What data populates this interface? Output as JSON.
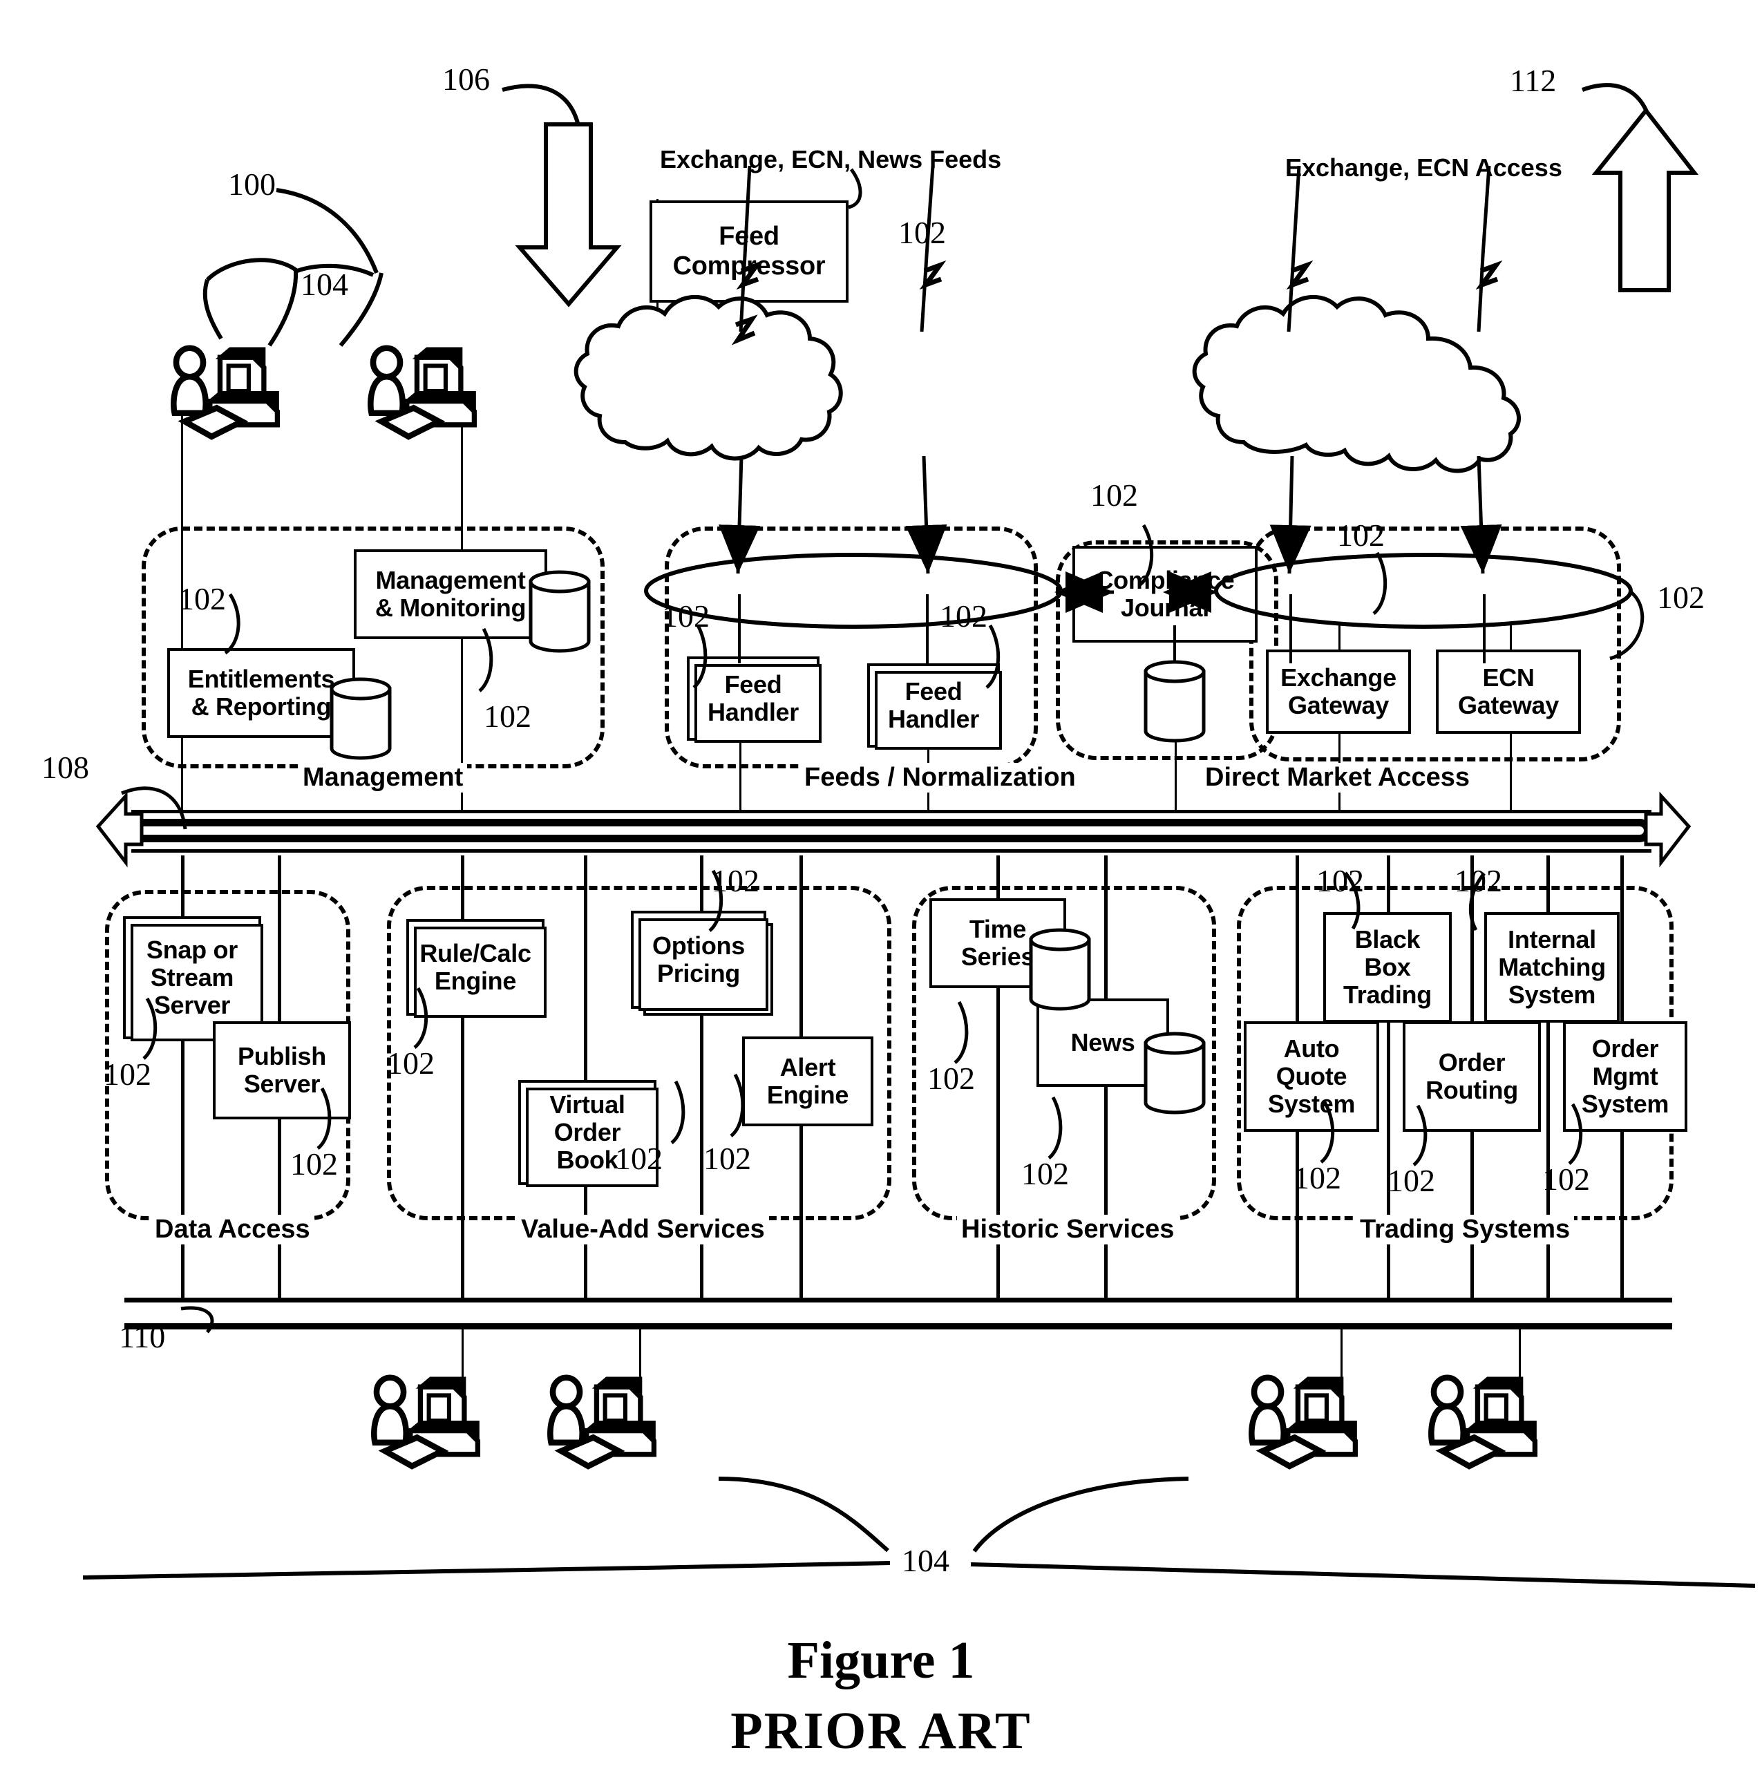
{
  "figure": {
    "title": "Figure 1",
    "subtitle": "PRIOR ART"
  },
  "reference_numerals": {
    "system": "100",
    "component": "102",
    "workstation": "104",
    "inbound_arrow": "106",
    "upper_bus": "108",
    "lower_bus": "110",
    "outbound_arrow": "112"
  },
  "external_labels": {
    "feeds_in": "Exchange, ECN, News Feeds",
    "market_access": "Exchange, ECN Access"
  },
  "top_components": [
    {
      "label": "Feed\nCompressor",
      "name": "feed-compressor"
    }
  ],
  "groups": [
    {
      "name": "management",
      "label": "Management",
      "boxes": [
        {
          "label": "Management\n& Monitoring",
          "name": "management-monitoring",
          "has_db": true
        },
        {
          "label": "Entitlements\n& Reporting",
          "name": "entitlements-reporting",
          "has_db": true
        }
      ]
    },
    {
      "name": "feeds-normalization",
      "label": "Feeds / Normalization",
      "boxes": [
        {
          "label": "Feed\nHandler",
          "name": "feed-handler-1",
          "stacked": true
        },
        {
          "label": "Feed\nHandler",
          "name": "feed-handler-2",
          "stacked": true
        }
      ]
    },
    {
      "name": "compliance",
      "label": "",
      "boxes": [
        {
          "label": "Compliance\nJournal",
          "name": "compliance-journal",
          "has_db": true
        }
      ]
    },
    {
      "name": "direct-market-access",
      "label": "Direct Market Access",
      "boxes": [
        {
          "label": "Exchange\nGateway",
          "name": "exchange-gateway"
        },
        {
          "label": "ECN\nGateway",
          "name": "ecn-gateway"
        }
      ]
    },
    {
      "name": "data-access",
      "label": "Data Access",
      "boxes": [
        {
          "label": "Snap or\nStream\nServer",
          "name": "snap-stream-server",
          "stacked": true
        },
        {
          "label": "Publish\nServer",
          "name": "publish-server"
        }
      ]
    },
    {
      "name": "value-add-services",
      "label": "Value-Add Services",
      "boxes": [
        {
          "label": "Rule/Calc\nEngine",
          "name": "rule-calc-engine",
          "stacked": true
        },
        {
          "label": "Options\nPricing",
          "name": "options-pricing",
          "stacked": true
        },
        {
          "label": "Virtual\nOrder\nBook",
          "name": "virtual-order-book",
          "stacked": true
        },
        {
          "label": "Alert\nEngine",
          "name": "alert-engine"
        }
      ]
    },
    {
      "name": "historic-services",
      "label": "Historic Services",
      "boxes": [
        {
          "label": "Time\nSeries",
          "name": "time-series",
          "has_db": true
        },
        {
          "label": "News",
          "name": "news",
          "has_db": true
        }
      ]
    },
    {
      "name": "trading-systems",
      "label": "Trading Systems",
      "boxes": [
        {
          "label": "Black\nBox\nTrading",
          "name": "black-box-trading"
        },
        {
          "label": "Internal\nMatching\nSystem",
          "name": "internal-matching-system"
        },
        {
          "label": "Auto\nQuote\nSystem",
          "name": "auto-quote-system"
        },
        {
          "label": "Order\nRouting",
          "name": "order-routing"
        },
        {
          "label": "Order\nMgmt\nSystem",
          "name": "order-mgmt-system"
        }
      ]
    }
  ],
  "box_text": {
    "feed_compressor_l1": "Feed",
    "feed_compressor_l2": "Compressor",
    "mgmt_monitoring_l1": "Management",
    "mgmt_monitoring_l2": "& Monitoring",
    "entitlements_l1": "Entitlements",
    "entitlements_l2": "& Reporting",
    "feed_handler_l1": "Feed",
    "feed_handler_l2": "Handler",
    "compliance_l1": "Compliance",
    "compliance_l2": "Journal",
    "exchange_gw_l1": "Exchange",
    "exchange_gw_l2": "Gateway",
    "ecn_gw_l1": "ECN",
    "ecn_gw_l2": "Gateway",
    "snap_l1": "Snap or",
    "snap_l2": "Stream",
    "snap_l3": "Server",
    "publish_l1": "Publish",
    "publish_l2": "Server",
    "rulecalc_l1": "Rule/Calc",
    "rulecalc_l2": "Engine",
    "options_l1": "Options",
    "options_l2": "Pricing",
    "vob_l1": "Virtual",
    "vob_l2": "Order",
    "vob_l3": "Book",
    "alert_l1": "Alert",
    "alert_l2": "Engine",
    "timeseries_l1": "Time",
    "timeseries_l2": "Series",
    "news_l1": "News",
    "blackbox_l1": "Black",
    "blackbox_l2": "Box",
    "blackbox_l3": "Trading",
    "internal_l1": "Internal",
    "internal_l2": "Matching",
    "internal_l3": "System",
    "autoquote_l1": "Auto",
    "autoquote_l2": "Quote",
    "autoquote_l3": "System",
    "orderrouting_l1": "Order",
    "orderrouting_l2": "Routing",
    "ordermgmt_l1": "Order",
    "ordermgmt_l2": "Mgmt",
    "ordermgmt_l3": "System"
  },
  "group_labels": {
    "management": "Management",
    "feeds": "Feeds / Normalization",
    "dma": "Direct Market Access",
    "data_access": "Data Access",
    "value_add": "Value-Add Services",
    "historic": "Historic Services",
    "trading": "Trading Systems"
  },
  "colors": {
    "ink": "#000000",
    "paper": "#ffffff"
  }
}
